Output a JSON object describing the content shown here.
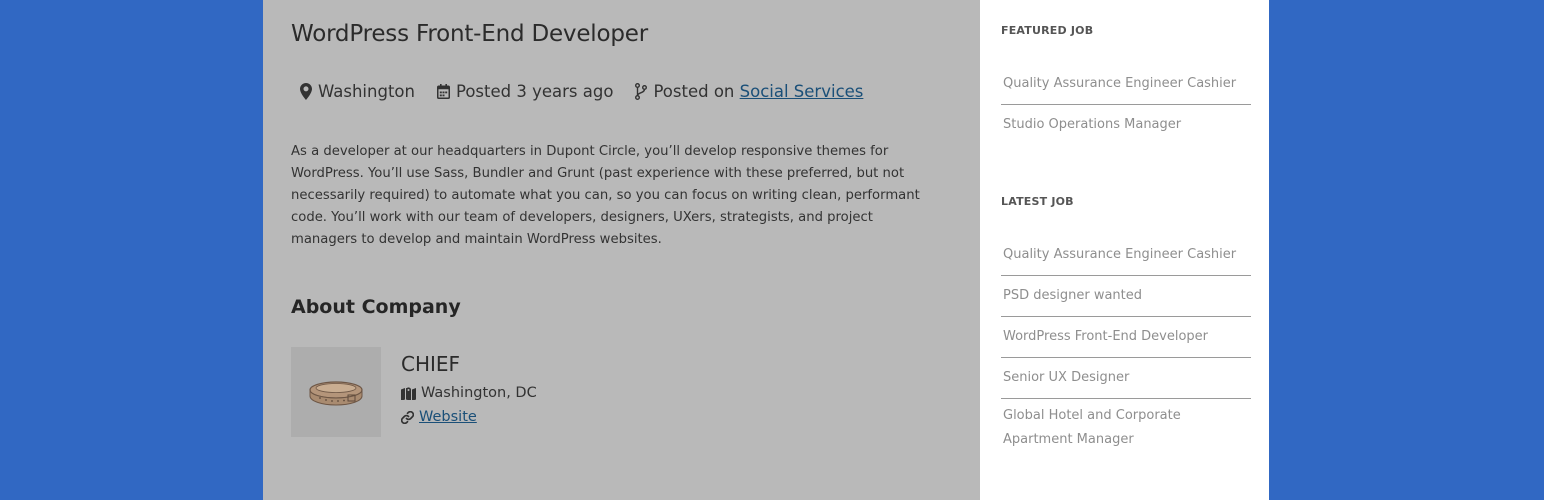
{
  "job": {
    "title": "WordPress Front-End Developer",
    "location": "Washington",
    "posted": "Posted 3 years ago",
    "posted_on_prefix": "Posted on",
    "posted_on_category": "Social Services",
    "description": "As a developer at our headquarters in Dupont Circle, you’ll develop responsive themes for WordPress. You’ll use Sass, Bundler and Grunt (past experience with these preferred, but not necessarily required) to automate what you can, so you can focus on writing clean, performant code. You’ll work with our team of developers, designers, UXers, strategists, and project managers to develop and maintain WordPress websites."
  },
  "company": {
    "heading": "About Company",
    "name": "CHIEF",
    "location": "Washington, DC",
    "website_label": "Website"
  },
  "sidebar": {
    "featured": {
      "heading": "FEATURED JOB",
      "items": [
        "Quality Assurance Engineer Cashier",
        "Studio Operations Manager"
      ]
    },
    "latest": {
      "heading": "LATEST JOB",
      "items": [
        "Quality Assurance Engineer Cashier",
        "PSD designer wanted",
        "WordPress Front-End Developer",
        "Senior UX Designer",
        "Global Hotel and Corporate Apartment Manager"
      ]
    }
  },
  "colors": {
    "page_background": "#3168c3",
    "content_background": "#b9b9b9",
    "sidebar_background": "#ffffff",
    "link": "#1a4f78",
    "sidebar_link": "#8e8e8e"
  },
  "icons": [
    "map-marker-icon",
    "calendar-icon",
    "code-branch-icon",
    "map-icon",
    "link-icon"
  ]
}
